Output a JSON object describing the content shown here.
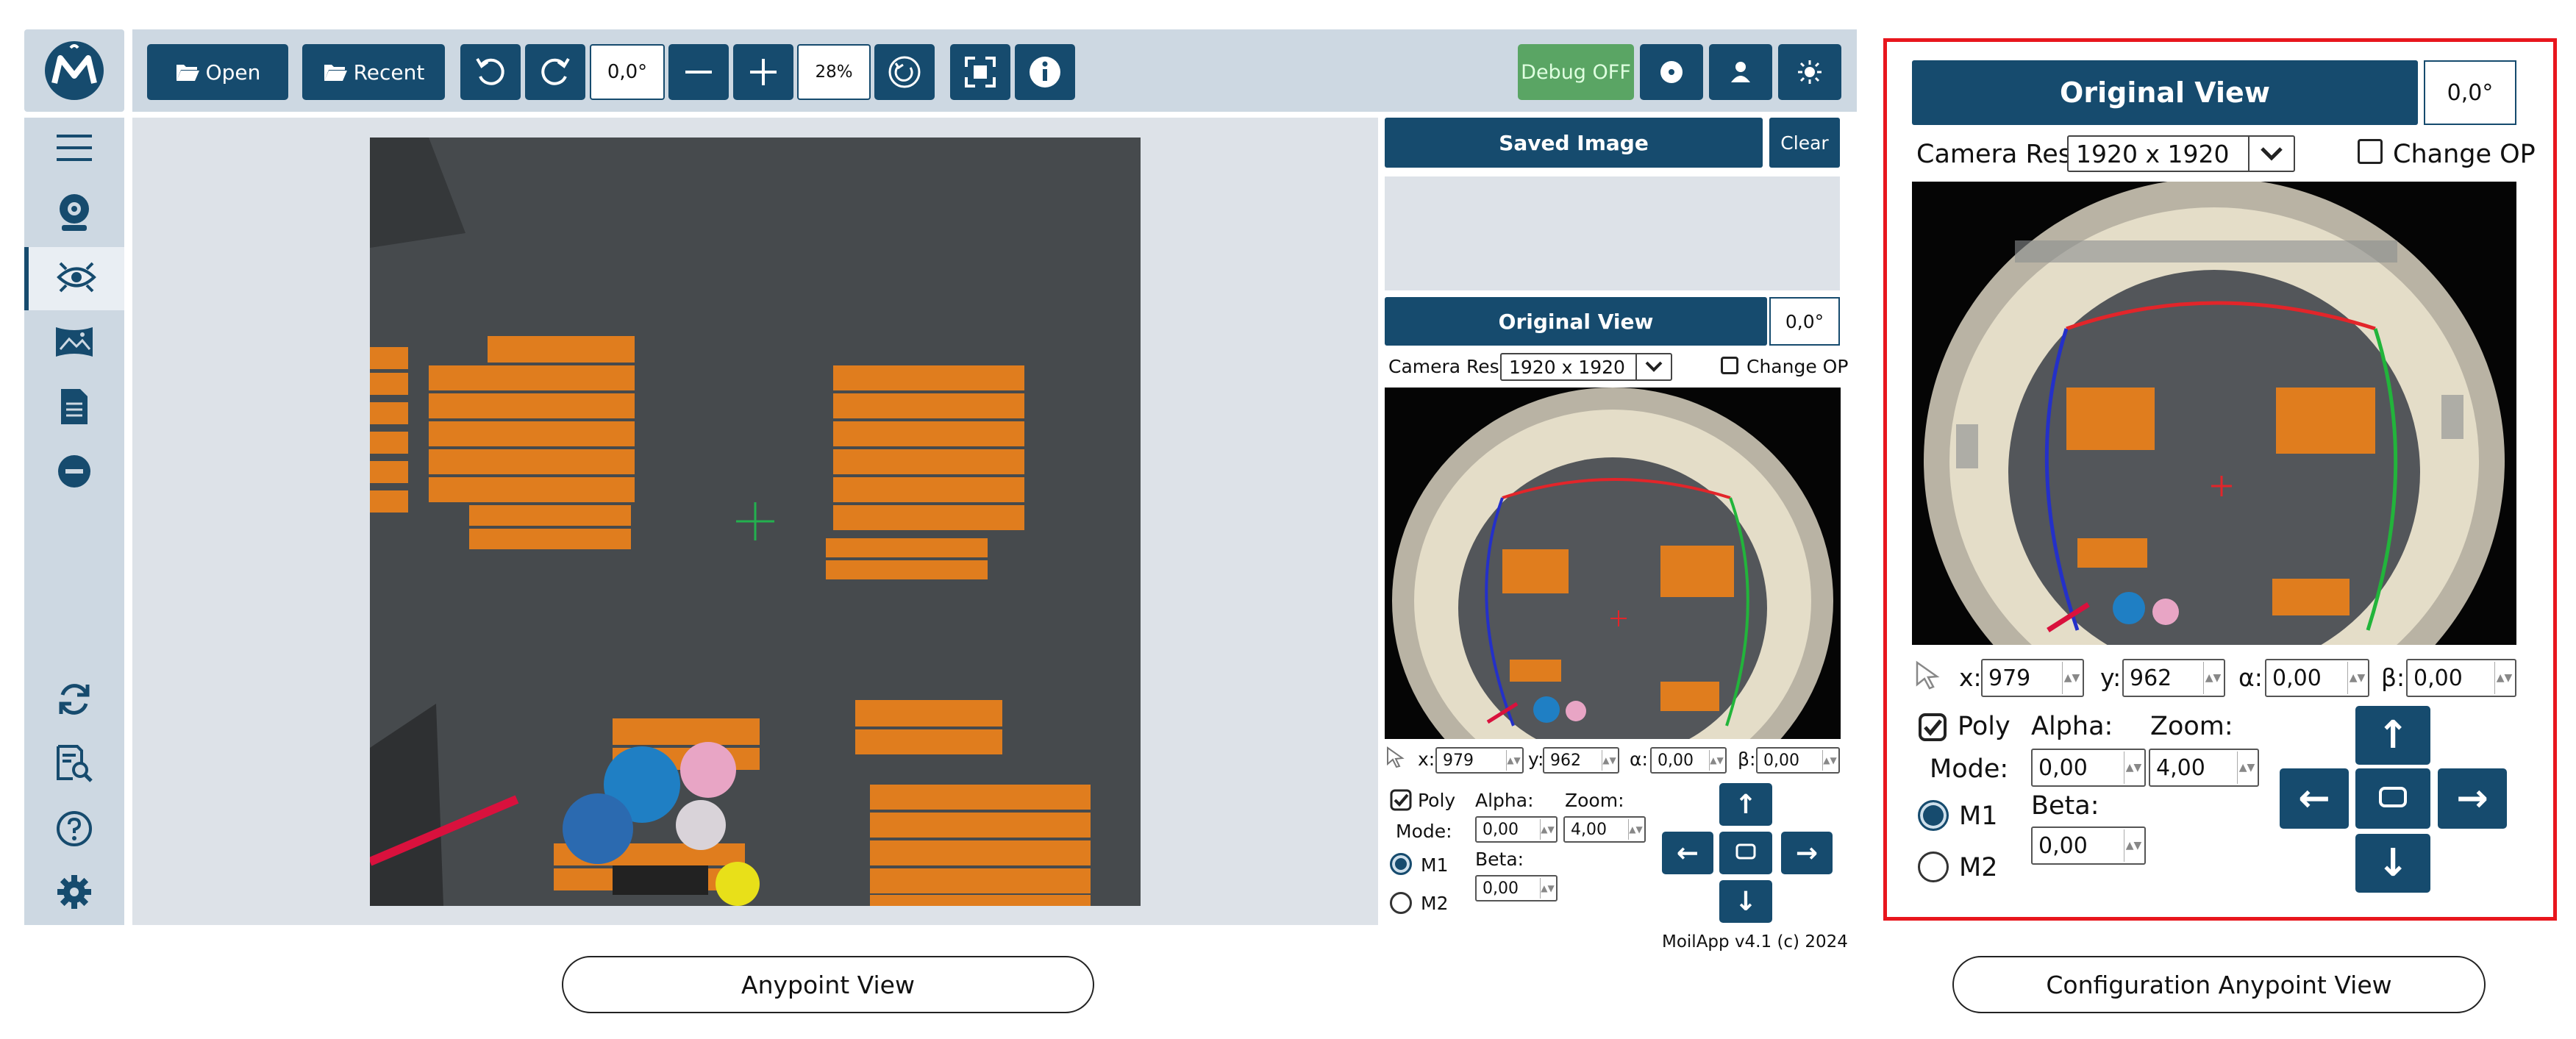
{
  "toolbar": {
    "open_label": "Open",
    "recent_label": "Recent",
    "rotation_value": "0,0°",
    "zoom_value": "28%",
    "debug_label": "Debug OFF"
  },
  "main": {
    "saved_image_label": "Saved Image",
    "clear_label": "Clear",
    "original_view_label": "Original View",
    "original_view_angle": "0,0°",
    "camera_res_label": "Camera Res :",
    "camera_res_value": "1920 x 1920",
    "change_op_label": "Change OP",
    "x_label": "x:",
    "x_value": "979",
    "y_label": "y:",
    "y_value": "962",
    "alpha_sym": "α:",
    "alpha_sym_value": "0,00",
    "beta_sym": "β:",
    "beta_sym_value": "0,00",
    "poly_label": "Poly",
    "mode_label": "Mode:",
    "alpha_label": "Alpha:",
    "alpha_value": "0,00",
    "zoom_label": "Zoom:",
    "zoom_value": "4,00",
    "beta_label": "Beta:",
    "beta_value": "0,00",
    "m1_label": "M1",
    "m2_label": "M2",
    "version": "MoilApp v4.1 (c) 2024",
    "arrows": {
      "up": "↑",
      "down": "↓",
      "left": "←",
      "right": "→"
    }
  },
  "config": {
    "original_view_label": "Original View",
    "original_view_angle": "0,0°",
    "camera_res_label": "Camera Res :",
    "camera_res_value": "1920 x 1920",
    "change_op_label": "Change OP",
    "x_label": "x:",
    "x_value": "979",
    "y_label": "y:",
    "y_value": "962",
    "alpha_sym": "α:",
    "alpha_sym_value": "0,00",
    "beta_sym": "β:",
    "beta_sym_value": "0,00",
    "poly_label": "Poly",
    "mode_label": "Mode:",
    "alpha_label": "Alpha:",
    "alpha_value": "0,00",
    "zoom_label": "Zoom:",
    "zoom_value": "4,00",
    "beta_label": "Beta:",
    "beta_value": "0,00",
    "m1_label": "M1",
    "m2_label": "M2"
  },
  "captions": {
    "left": "Anypoint View",
    "right": "Configuration Anypoint View"
  },
  "colors": {
    "primary": "#164b6e",
    "panel": "#cdd8e2",
    "debug": "#5aa564",
    "highlight": "#e8161d"
  }
}
